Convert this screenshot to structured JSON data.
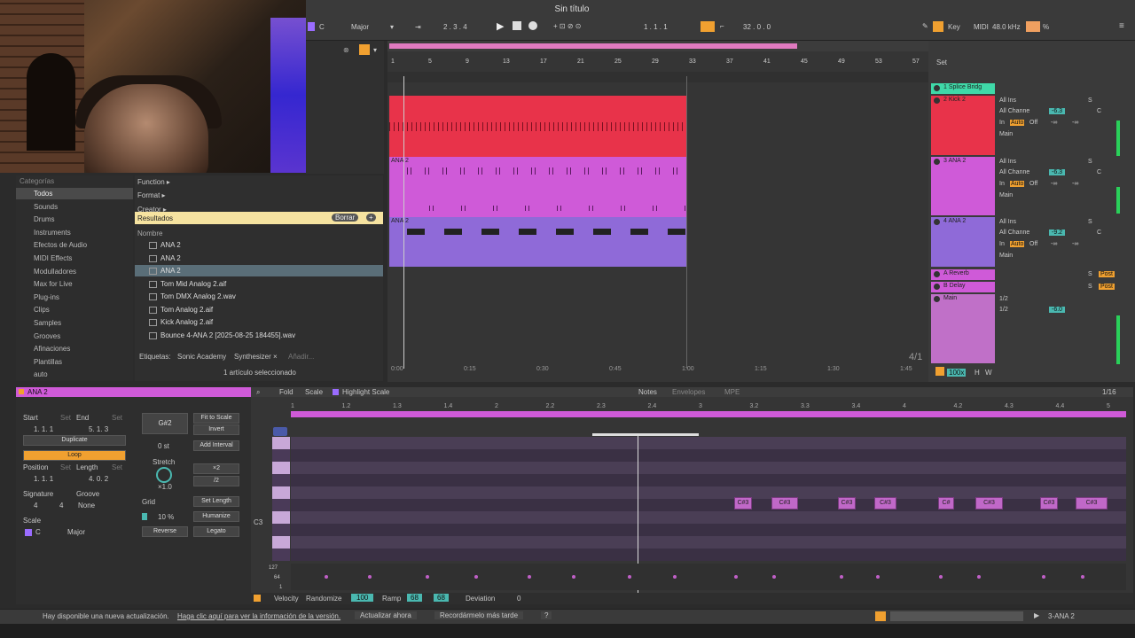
{
  "window": {
    "title": "Sin título"
  },
  "transport": {
    "key": "C",
    "scale": "Major",
    "signature": "2 . 3 . 4",
    "position": "1 . 1 . 1",
    "loop_len": "32 . 0 . 0",
    "key_label": "Key",
    "midi_label": "MIDI",
    "sample_rate": "48.0 kHz",
    "cpu": "%"
  },
  "browser": {
    "categories_title": "Categorías",
    "categories": [
      "Todos",
      "Sounds",
      "Drums",
      "Instruments",
      "Efectos de Audio",
      "MIDI Effects",
      "Modulladores",
      "Max for Live",
      "Plug-ins",
      "Clips",
      "Samples",
      "Grooves",
      "Afinaciones",
      "Plantillas",
      "auto"
    ],
    "filters": [
      "Function ▸",
      "Format ▸",
      "Creator ▸"
    ],
    "results_label": "Resultados",
    "clear_label": "Borrar",
    "name_header": "Nombre",
    "files": [
      "ANA 2",
      "ANA 2",
      "ANA 2",
      "Tom Mid Analog 2.aif",
      "Tom DMX Analog 2.wav",
      "Tom Analog 2.aif",
      "Kick Analog 2.aif",
      "Bounce 4-ANA 2 [2025-08-25 184455].wav"
    ],
    "tags_label": "Etiquetas:",
    "tags": [
      "Sonic Academy",
      "Synthesizer ×",
      "Añadir..."
    ],
    "selection_status": "1 artículo seleccionado"
  },
  "arrangement": {
    "bar_numbers": [
      "1",
      "5",
      "9",
      "13",
      "17",
      "21",
      "25",
      "29",
      "33",
      "37",
      "41",
      "45",
      "49",
      "53",
      "57"
    ],
    "time_labels": [
      "0:00",
      "0:15",
      "0:30",
      "0:45",
      "1:00",
      "1:15",
      "1:30",
      "1:45"
    ],
    "zoom_label": "4/1",
    "set_label": "Set",
    "clip_labels": [
      "ANA 2",
      "ANA 2"
    ]
  },
  "tracks": [
    {
      "name": "1 Splice Bridg",
      "color": "#3fd9a8",
      "input": "",
      "channel": ""
    },
    {
      "name": "2 Kick 2",
      "color": "#e8334a",
      "input": "All Ins",
      "channel": "All Channe",
      "vol": "-6.3"
    },
    {
      "name": "3 ANA 2",
      "color": "#cf5ad8",
      "input": "All Ins",
      "channel": "All Channe",
      "vol": "-6.3"
    },
    {
      "name": "4 ANA 2",
      "color": "#8f6ad8",
      "input": "All Ins",
      "channel": "All Channe",
      "vol": "-9.2"
    },
    {
      "name": "A Reverb",
      "color": "#cf5ad8",
      "input": "",
      "channel": ""
    },
    {
      "name": "B Delay",
      "color": "#cf5ad8",
      "input": "",
      "channel": ""
    },
    {
      "name": "Main",
      "color": "#c070c8",
      "input": "1/2",
      "channel": "1/2",
      "vol": "-6.0"
    }
  ],
  "mixer": {
    "in_label": "In",
    "auto_label": "Auto",
    "off_label": "Off",
    "main_label": "Main",
    "inf": "-∞",
    "s_label": "S",
    "c_label": "C",
    "post_label": "Post",
    "zoom": "100x",
    "h_label": "H",
    "w_label": "W"
  },
  "clip": {
    "name": "ANA 2",
    "start_label": "Start",
    "end_label": "End",
    "set_label": "Set",
    "start": "1. 1. 1",
    "end": "5. 1. 3",
    "duplicate": "Duplicate",
    "loop": "Loop",
    "position_label": "Position",
    "length_label": "Length",
    "position": "1. 1. 1",
    "length": "4. 0. 2",
    "signature_label": "Signature",
    "groove_label": "Groove",
    "sig_num": "4",
    "sig_den": "4",
    "groove": "None",
    "scale_label": "Scale",
    "scale_key": "C",
    "scale_mode": "Major",
    "note_name": "G#2",
    "fit_to_scale": "Fit to Scale",
    "invert": "Invert",
    "semitones": "0 st",
    "add_interval": "Add Interval",
    "stretch_label": "Stretch",
    "stretch_val": "×1.0",
    "x2": "×2",
    "div2": "/2",
    "grid_label": "Grid",
    "set_length": "Set Length",
    "percent": "10 %",
    "humanize": "Humanize",
    "reverse": "Reverse",
    "legato": "Legato"
  },
  "editor": {
    "fold": "Fold",
    "scale": "Scale",
    "highlight_scale": "Highlight Scale",
    "tabs": [
      "Notes",
      "Envelopes",
      "MPE"
    ],
    "grid": "1/16",
    "ruler": [
      "1",
      "1.2",
      "1.3",
      "1.4",
      "2",
      "2.2",
      "2.3",
      "2.4",
      "3",
      "3.2",
      "3.3",
      "3.4",
      "4",
      "4.2",
      "4.3",
      "4.4",
      "5"
    ],
    "c3_label": "C3",
    "notes": [
      "C#3",
      "C#3",
      "C#3",
      "C#3",
      "C#",
      "C#3",
      "C#3",
      "C#3"
    ],
    "vel_labels": [
      "127",
      "64",
      "1"
    ],
    "velocity_label": "Velocity",
    "randomize": "Randomize",
    "rand_val": "100",
    "ramp": "Ramp",
    "ramp_a": "68",
    "ramp_b": "68",
    "deviation_label": "Deviation",
    "deviation": "0"
  },
  "statusbar": {
    "message": "Hay disponible una nueva actualización.",
    "link": "Haga clic aquí para ver la información de la versión.",
    "update_now": "Actualizar ahora",
    "remind": "Recordármelo más tarde",
    "help": "?",
    "track": "3-ANA 2"
  }
}
